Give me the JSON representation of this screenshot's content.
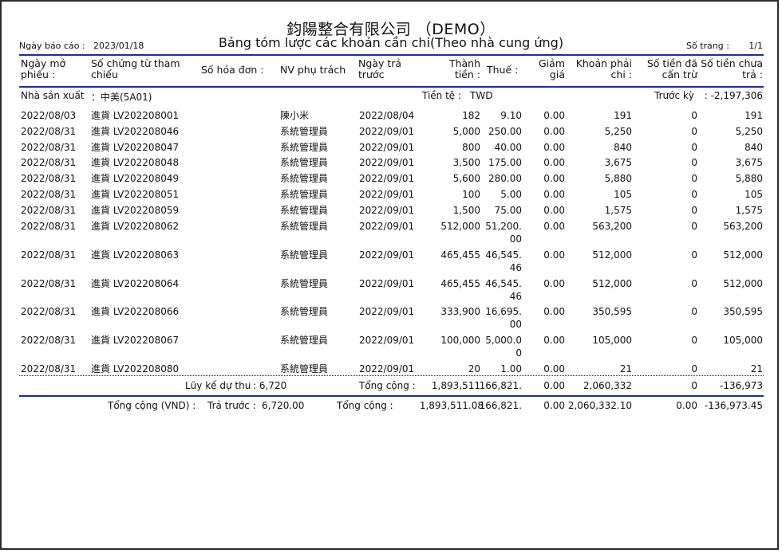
{
  "header": {
    "company": "鈞陽整合有限公司 （DEMO）",
    "title": "Bảng tóm lược các khoản cần chi(Theo nhà cung ứng)",
    "report_date_label": "Ngày báo cáo :",
    "report_date": "2023/01/18",
    "page_label": "Số trang :",
    "page_value": "1/1"
  },
  "columns": {
    "open_date": "Ngày mở\nphiếu :",
    "ref_no": "Số chứng từ tham\nchiếu",
    "invoice": "Số hóa đơn :",
    "staff": "NV phụ trách",
    "due_date": "Ngày trả\ntrước",
    "amount": "Thành\ntiền :",
    "tax": "Thuế :",
    "discount": "Giảm\ngiá",
    "payable": "Khoản phải\nchi :",
    "offset": "Số tiền đã\ncấn trừ",
    "unpaid": "Số tiền chưa\ntrả :"
  },
  "supplier": {
    "label": "Nhà sản xuất",
    "name": "：中美(5A01)",
    "currency_label": "Tiền tệ :",
    "currency": "TWD",
    "prior_label": "Trước kỳ",
    "prior_value": ": -2,197,306"
  },
  "rows": [
    {
      "date": "2022/08/03",
      "ref": "進貨 LV202208001",
      "staff": "陳小米",
      "due": "2022/08/04",
      "amount": "182",
      "tax": "9.10",
      "disc": "0.00",
      "payable": "191",
      "offset": "0",
      "unpaid": "191"
    },
    {
      "date": "2022/08/31",
      "ref": "進貨 LV202208046",
      "staff": "系統管理員",
      "due": "2022/09/01",
      "amount": "5,000",
      "tax": "250.00",
      "disc": "0.00",
      "payable": "5,250",
      "offset": "0",
      "unpaid": "5,250"
    },
    {
      "date": "2022/08/31",
      "ref": "進貨 LV202208047",
      "staff": "系統管理員",
      "due": "2022/09/01",
      "amount": "800",
      "tax": "40.00",
      "disc": "0.00",
      "payable": "840",
      "offset": "0",
      "unpaid": "840"
    },
    {
      "date": "2022/08/31",
      "ref": "進貨 LV202208048",
      "staff": "系統管理員",
      "due": "2022/09/01",
      "amount": "3,500",
      "tax": "175.00",
      "disc": "0.00",
      "payable": "3,675",
      "offset": "0",
      "unpaid": "3,675"
    },
    {
      "date": "2022/08/31",
      "ref": "進貨 LV202208049",
      "staff": "系統管理員",
      "due": "2022/09/01",
      "amount": "5,600",
      "tax": "280.00",
      "disc": "0.00",
      "payable": "5,880",
      "offset": "0",
      "unpaid": "5,880"
    },
    {
      "date": "2022/08/31",
      "ref": "進貨 LV202208051",
      "staff": "系統管理員",
      "due": "2022/09/01",
      "amount": "100",
      "tax": "5.00",
      "disc": "0.00",
      "payable": "105",
      "offset": "0",
      "unpaid": "105"
    },
    {
      "date": "2022/08/31",
      "ref": "進貨 LV202208059",
      "staff": "系統管理員",
      "due": "2022/09/01",
      "amount": "1,500",
      "tax": "75.00",
      "disc": "0.00",
      "payable": "1,575",
      "offset": "0",
      "unpaid": "1,575"
    },
    {
      "date": "2022/08/31",
      "ref": "進貨 LV202208062",
      "staff": "系統管理員",
      "due": "2022/09/01",
      "amount": "512,000",
      "tax": "51,200.\n00",
      "disc": "0.00",
      "payable": "563,200",
      "offset": "0",
      "unpaid": "563,200"
    },
    {
      "date": "2022/08/31",
      "ref": "進貨 LV202208063",
      "staff": "系統管理員",
      "due": "2022/09/01",
      "amount": "465,455",
      "tax": "46,545.\n46",
      "disc": "0.00",
      "payable": "512,000",
      "offset": "0",
      "unpaid": "512,000"
    },
    {
      "date": "2022/08/31",
      "ref": "進貨 LV202208064",
      "staff": "系統管理員",
      "due": "2022/09/01",
      "amount": "465,455",
      "tax": "46,545.\n46",
      "disc": "0.00",
      "payable": "512,000",
      "offset": "0",
      "unpaid": "512,000"
    },
    {
      "date": "2022/08/31",
      "ref": "進貨 LV202208066",
      "staff": "系統管理員",
      "due": "2022/09/01",
      "amount": "333,900",
      "tax": "16,695.\n00",
      "disc": "0.00",
      "payable": "350,595",
      "offset": "0",
      "unpaid": "350,595"
    },
    {
      "date": "2022/08/31",
      "ref": "進貨 LV202208067",
      "staff": "系統管理員",
      "due": "2022/09/01",
      "amount": "100,000",
      "tax": "5,000.0\n0",
      "disc": "0.00",
      "payable": "105,000",
      "offset": "0",
      "unpaid": "105,000"
    },
    {
      "date": "2022/08/31",
      "ref": "進貨 LV202208080",
      "staff": "系統管理員",
      "due": "2022/09/01",
      "amount": "20",
      "tax": "1.00",
      "disc": "0.00",
      "payable": "21",
      "offset": "0",
      "unpaid": "21"
    }
  ],
  "subtotal": {
    "accum_label": "Lũy kế dự thu",
    "accum_value": ": 6,720",
    "total_label": "Tổng cộng :",
    "amount": "1,893,511",
    "tax": "166,821.",
    "disc": "0.00",
    "payable": "2,060,332",
    "offset": "0",
    "unpaid": "-136,973"
  },
  "grand_total": {
    "label": "Tổng cộng (VND) :",
    "prepaid_label": "Trả trước :",
    "prepaid_value": "6,720.00",
    "total_label": "Tổng cộng :",
    "amount": "1,893,511.08",
    "tax": "166,821.",
    "disc": "0.00",
    "payable": "2,060,332.10",
    "offset": "0.00",
    "unpaid": "-136,973.45"
  }
}
